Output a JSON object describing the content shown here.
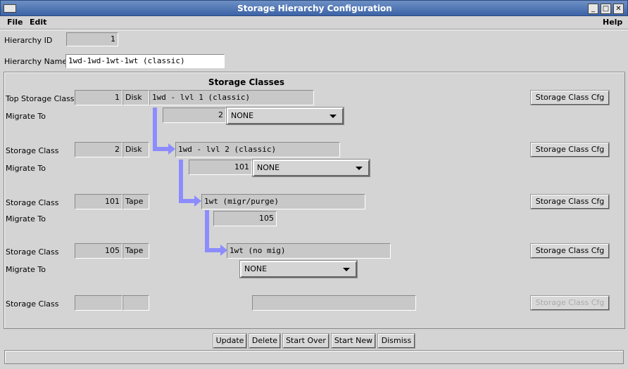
{
  "window": {
    "title": "Storage Hierarchy Configuration"
  },
  "menu": {
    "file": "File",
    "edit": "Edit",
    "help": "Help"
  },
  "hierarchy": {
    "id_label": "Hierarchy ID",
    "id": "1",
    "name_label": "Hierarchy Name",
    "name": "1wd-1wd-1wt-1wt (classic)"
  },
  "panel": {
    "title": "Storage Classes",
    "migrate_label": "Migrate To",
    "cfg_label": "Storage Class Cfg"
  },
  "rows": [
    {
      "label": "Top Storage Class",
      "id": "1",
      "type": "Disk",
      "name": "1wd - lvl 1 (classic)",
      "migrate_id": "2",
      "migrate_select": "NONE"
    },
    {
      "label": "Storage Class",
      "id": "2",
      "type": "Disk",
      "name": "1wd - lvl 2 (classic)",
      "migrate_id": "101",
      "migrate_select": "NONE"
    },
    {
      "label": "Storage Class",
      "id": "101",
      "type": "Tape",
      "name": "1wt (migr/purge)",
      "migrate_id": "105"
    },
    {
      "label": "Storage Class",
      "id": "105",
      "type": "Tape",
      "name": "1wt (no mig)",
      "migrate_select": "NONE"
    },
    {
      "label": "Storage Class",
      "id": "",
      "type": "",
      "name": ""
    }
  ],
  "buttons": {
    "update": "Update",
    "delete": "Delete",
    "start_over": "Start Over",
    "start_new": "Start New",
    "dismiss": "Dismiss"
  },
  "colors": {
    "arrow": "#8c8cff",
    "titlebar": "#4a6fb0"
  }
}
